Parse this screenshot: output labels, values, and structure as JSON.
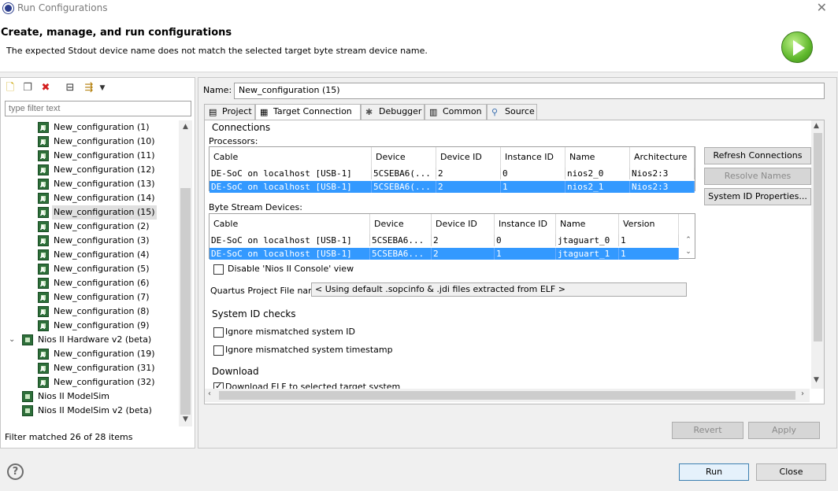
{
  "window": {
    "title": "Run Configurations"
  },
  "header": {
    "heading": "Create, manage, and run configurations",
    "message": "The expected Stdout device name does not match the selected target byte stream device name."
  },
  "left": {
    "filter_placeholder": "type filter text",
    "tree": [
      {
        "label": "New_configuration (1)",
        "level": 2
      },
      {
        "label": "New_configuration (10)",
        "level": 2
      },
      {
        "label": "New_configuration (11)",
        "level": 2
      },
      {
        "label": "New_configuration (12)",
        "level": 2
      },
      {
        "label": "New_configuration (13)",
        "level": 2
      },
      {
        "label": "New_configuration (14)",
        "level": 2
      },
      {
        "label": "New_configuration (15)",
        "level": 2,
        "selected": true
      },
      {
        "label": "New_configuration (2)",
        "level": 2
      },
      {
        "label": "New_configuration (3)",
        "level": 2
      },
      {
        "label": "New_configuration (4)",
        "level": 2
      },
      {
        "label": "New_configuration (5)",
        "level": 2
      },
      {
        "label": "New_configuration (6)",
        "level": 2
      },
      {
        "label": "New_configuration (7)",
        "level": 2
      },
      {
        "label": "New_configuration (8)",
        "level": 2
      },
      {
        "label": "New_configuration (9)",
        "level": 2
      },
      {
        "label": "Nios II Hardware v2 (beta)",
        "level": 1,
        "expanded": true
      },
      {
        "label": "New_configuration (19)",
        "level": 2
      },
      {
        "label": "New_configuration (31)",
        "level": 2
      },
      {
        "label": "New_configuration (32)",
        "level": 2
      },
      {
        "label": "Nios II ModelSim",
        "level": 1
      },
      {
        "label": "Nios II ModelSim v2 (beta)",
        "level": 1
      }
    ],
    "filter_status": "Filter matched 26 of 28 items"
  },
  "right": {
    "name_label": "Name:",
    "name_value": "New_configuration (15)",
    "tabs": [
      {
        "label": "Project",
        "icon": "page-icon"
      },
      {
        "label": "Target Connection",
        "icon": "chip-icon",
        "active": true
      },
      {
        "label": "Debugger",
        "icon": "bug-icon"
      },
      {
        "label": "Common",
        "icon": "table-icon"
      },
      {
        "label": "Source",
        "icon": "source-icon"
      }
    ],
    "connections": {
      "title": "Connections",
      "processors_label": "Processors:",
      "processor_headers": [
        "Cable",
        "Device",
        "Device ID",
        "Instance ID",
        "Name",
        "Architecture"
      ],
      "processor_rows": [
        [
          "DE-SoC on localhost [USB-1]",
          "5CSEBA6(...",
          "2",
          "0",
          "nios2_0",
          "Nios2:3"
        ],
        [
          "DE-SoC on localhost [USB-1]",
          "5CSEBA6(...",
          "2",
          "1",
          "nios2_1",
          "Nios2:3"
        ]
      ],
      "bytestream_label": "Byte Stream Devices:",
      "bytestream_headers": [
        "Cable",
        "Device",
        "Device ID",
        "Instance ID",
        "Name",
        "Version"
      ],
      "bytestream_rows": [
        [
          "DE-SoC on localhost [USB-1]",
          "5CSEBA6...",
          "2",
          "0",
          "jtaguart_0",
          "1"
        ],
        [
          "DE-SoC on localhost [USB-1]",
          "5CSEBA6...",
          "2",
          "1",
          "jtaguart_1",
          "1"
        ]
      ],
      "disable_console_label": "Disable 'Nios II Console' view",
      "quartus_label": "Quartus Project File name:",
      "quartus_value": "< Using default .sopcinfo & .jdi files extracted from ELF >",
      "refresh_button": "Refresh Connections",
      "resolve_button": "Resolve Names",
      "sysid_button": "System ID Properties..."
    },
    "sysid": {
      "title": "System ID checks",
      "ignore_id": "Ignore mismatched system ID",
      "ignore_timestamp": "Ignore mismatched system timestamp"
    },
    "download": {
      "title": "Download",
      "download_elf": "Download ELF to selected target system"
    },
    "revert_button": "Revert",
    "apply_button": "Apply"
  },
  "footer": {
    "run_button": "Run",
    "close_button": "Close"
  },
  "colors": {
    "selection": "#3399ff",
    "run_green": "#5fb82c"
  }
}
